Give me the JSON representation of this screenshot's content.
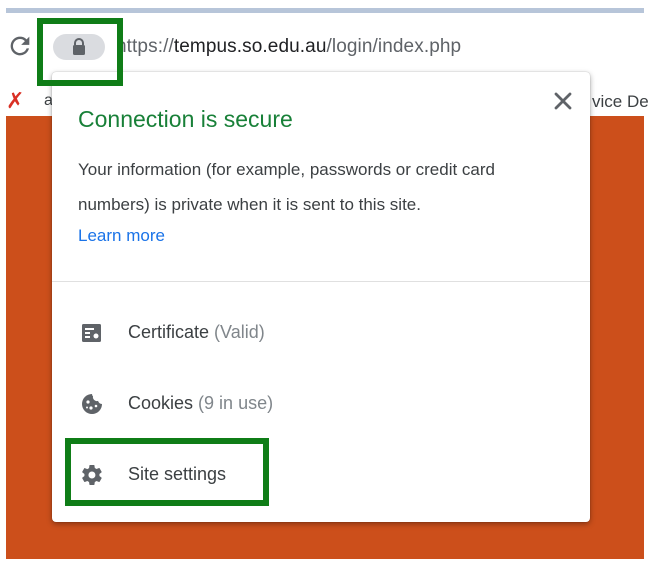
{
  "browser": {
    "address_bar": {
      "scheme_clip": "h",
      "visible_scheme": "ttps://",
      "host": "tempus.so.edu.au",
      "path": "/login/index.php"
    },
    "bookmarks": {
      "first_label": "a",
      "truncated_label": "vice De"
    }
  },
  "site_info_popup": {
    "title": "Connection is secure",
    "description": "Your information (for example, passwords or credit card numbers) is private when it is sent to this site.",
    "learn_more": "Learn more",
    "items": [
      {
        "label": "Certificate",
        "detail": "(Valid)",
        "icon": "certificate-icon"
      },
      {
        "label": "Cookies",
        "detail": "(9 in use)",
        "icon": "cookie-icon"
      },
      {
        "label": "Site settings",
        "detail": "",
        "icon": "gear-icon"
      }
    ]
  },
  "colors": {
    "secure_green": "#188038",
    "link_blue": "#1a73e8",
    "highlight_green": "#0f7d17",
    "page_orange": "#cc4f1b",
    "bookmark_x_red": "#d93025"
  }
}
